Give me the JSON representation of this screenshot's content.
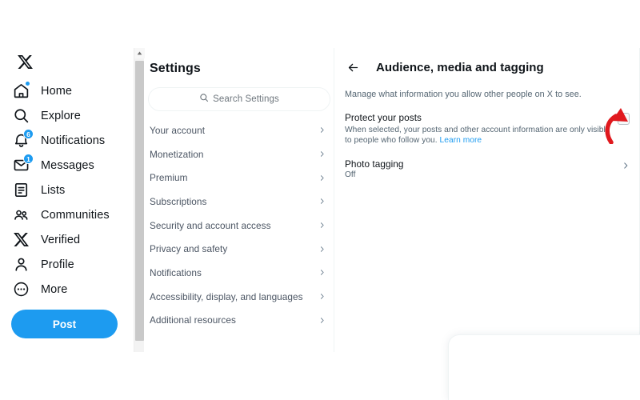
{
  "brand": {
    "logo_icon": "x-logo-icon",
    "accent_color": "#1d9bf0",
    "annotation_color": "#e0191e"
  },
  "sidebar": {
    "items": [
      {
        "label": "Home",
        "icon": "home-icon",
        "badge": "",
        "dot": true
      },
      {
        "label": "Explore",
        "icon": "search-icon",
        "badge": "",
        "dot": false
      },
      {
        "label": "Notifications",
        "icon": "bell-icon",
        "badge": "6",
        "dot": false
      },
      {
        "label": "Messages",
        "icon": "envelope-icon",
        "badge": "1",
        "dot": false
      },
      {
        "label": "Lists",
        "icon": "list-icon",
        "badge": "",
        "dot": false
      },
      {
        "label": "Communities",
        "icon": "communities-icon",
        "badge": "",
        "dot": false
      },
      {
        "label": "Verified",
        "icon": "x-verified-icon",
        "badge": "",
        "dot": false
      },
      {
        "label": "Profile",
        "icon": "person-icon",
        "badge": "",
        "dot": false
      },
      {
        "label": "More",
        "icon": "more-circle-icon",
        "badge": "",
        "dot": false
      }
    ],
    "post_label": "Post"
  },
  "settings": {
    "title": "Settings",
    "search": {
      "placeholder": "Search Settings",
      "value": "",
      "icon": "search-icon"
    },
    "items": [
      {
        "label": "Your account"
      },
      {
        "label": "Monetization"
      },
      {
        "label": "Premium"
      },
      {
        "label": "Subscriptions"
      },
      {
        "label": "Security and account access"
      },
      {
        "label": "Privacy and safety"
      },
      {
        "label": "Notifications"
      },
      {
        "label": "Accessibility, display, and languages"
      },
      {
        "label": "Additional resources"
      }
    ]
  },
  "detail": {
    "back_icon": "arrow-left-icon",
    "title": "Audience, media and tagging",
    "description": "Manage what information you allow other people on X to see.",
    "options": [
      {
        "title": "Protect your posts",
        "subtitle": "When selected, your posts and other account information are only visible to people who follow you.",
        "link_label": "Learn more",
        "control": "checkbox",
        "checked": false
      },
      {
        "title": "Photo tagging",
        "value": "Off",
        "control": "chevron"
      }
    ]
  }
}
